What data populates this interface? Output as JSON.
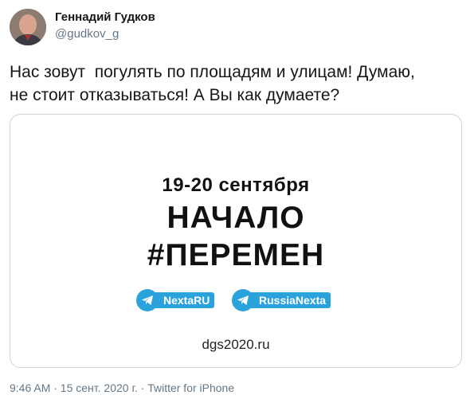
{
  "author": {
    "name": "Геннадий Гудков",
    "handle": "@gudkov_g",
    "avatar_icon": "profile-photo-avatar"
  },
  "tweet": {
    "text": "Нас зовут  погулять по площадям и улицам! Думаю,\nне стоит отказываться! А Вы как думаете?"
  },
  "card": {
    "dates": "19-20 сентября",
    "line1": "НАЧАЛО",
    "line2": "#ПЕРЕМЕН",
    "channels": [
      {
        "label": "NextaRU",
        "icon": "telegram-icon"
      },
      {
        "label": "RussiaNexta",
        "icon": "telegram-icon"
      }
    ],
    "site": "dgs2020.ru",
    "accent_color": "#2aa3dd"
  },
  "footer": {
    "meta": "9:46 AM · 15 сент. 2020 г. · Twitter for iPhone"
  }
}
